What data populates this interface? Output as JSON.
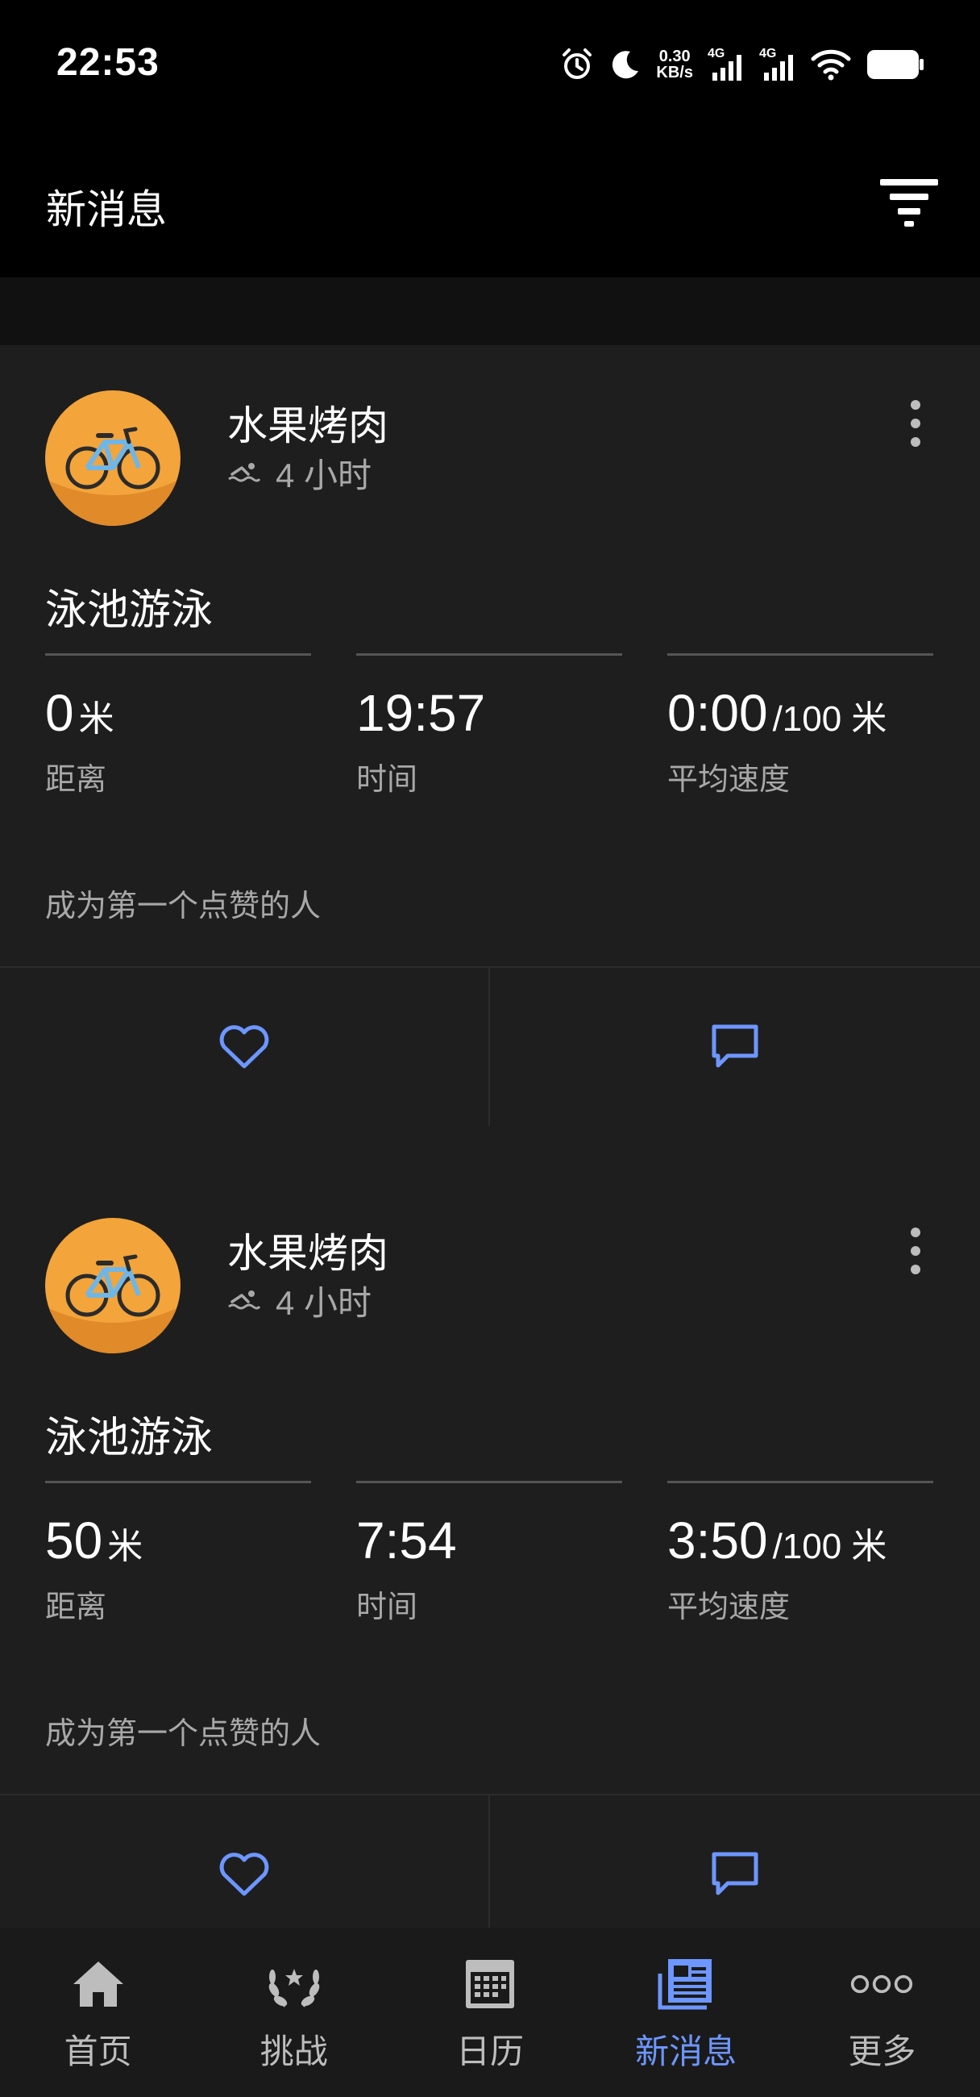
{
  "status_bar": {
    "time": "22:53",
    "net_speed_value": "0.30",
    "net_speed_unit": "KB/s",
    "signal1_label": "4G",
    "signal2_label": "4G",
    "icons": [
      "alarm-icon",
      "moon-icon",
      "signal-icon",
      "signal-icon",
      "wifi-icon",
      "battery-icon"
    ]
  },
  "header": {
    "title": "新消息",
    "filter_icon": "filter-icon"
  },
  "feed": {
    "cards": [
      {
        "user_name": "水果烤肉",
        "time_ago": "4 小时",
        "activity_title": "泳池游泳",
        "stats": [
          {
            "value": "0",
            "unit": "米",
            "label": "距离"
          },
          {
            "value": "19:57",
            "unit": "",
            "label": "时间"
          },
          {
            "value": "0:00",
            "unit": "/100 米",
            "label": "平均速度"
          }
        ],
        "like_prompt": "成为第一个点赞的人"
      },
      {
        "user_name": "水果烤肉",
        "time_ago": "4 小时",
        "activity_title": "泳池游泳",
        "stats": [
          {
            "value": "50",
            "unit": "米",
            "label": "距离"
          },
          {
            "value": "7:54",
            "unit": "",
            "label": "时间"
          },
          {
            "value": "3:50",
            "unit": "/100 米",
            "label": "平均速度"
          }
        ],
        "like_prompt": "成为第一个点赞的人"
      }
    ]
  },
  "bottom_nav": {
    "items": [
      {
        "label": "首页",
        "icon": "home-icon",
        "active": false
      },
      {
        "label": "挑战",
        "icon": "laurel-icon",
        "active": false
      },
      {
        "label": "日历",
        "icon": "calendar-icon",
        "active": false
      },
      {
        "label": "新消息",
        "icon": "newsfeed-icon",
        "active": true
      },
      {
        "label": "更多",
        "icon": "more-dots-icon",
        "active": false
      }
    ]
  },
  "colors": {
    "accent": "#6d96ff",
    "background": "#000000",
    "card": "#1e1e1e",
    "avatar": "#f3a43a"
  }
}
